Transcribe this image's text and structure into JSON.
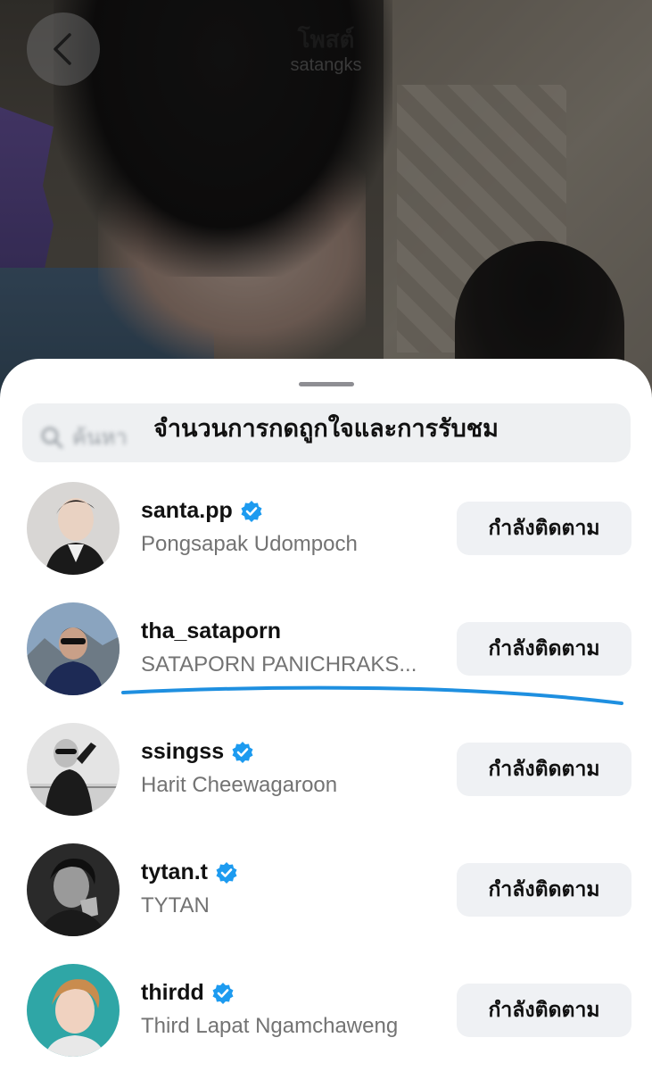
{
  "header": {
    "title": "โพสต์",
    "username": "satangks",
    "back_icon": "chevron-left-icon"
  },
  "sheet": {
    "title": "จำนวนการกดถูกใจและการรับชม",
    "search_placeholder": "ค้นหา",
    "search_icon": "search-icon"
  },
  "users": [
    {
      "username": "santa.pp",
      "full_name": "Pongsapak Udompoch",
      "verified": true,
      "button_label": "กำลังติดตาม"
    },
    {
      "username": "tha_sataporn",
      "full_name": "SATAPORN PANICHRAKS...",
      "verified": false,
      "button_label": "กำลังติดตาม"
    },
    {
      "username": "ssingss",
      "full_name": "Harit Cheewagaroon",
      "verified": true,
      "button_label": "กำลังติดตาม"
    },
    {
      "username": "tytan.t",
      "full_name": "TYTAN",
      "verified": true,
      "button_label": "กำลังติดตาม"
    },
    {
      "username": "thirdd",
      "full_name": "Third Lapat Ngamchaweng",
      "verified": true,
      "button_label": "กำลังติดตาม"
    }
  ],
  "colors": {
    "verified_badge": "#1d9bf0",
    "annotation_stroke": "#1e8fe0",
    "button_bg": "#eff1f4"
  }
}
